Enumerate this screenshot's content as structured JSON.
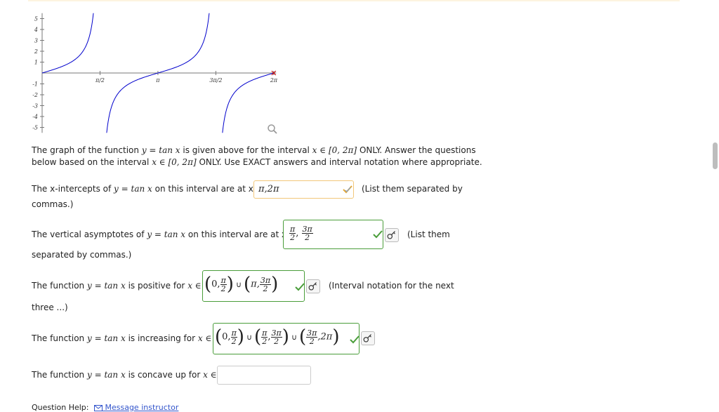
{
  "graph": {
    "y_labels": [
      "5",
      "4",
      "3",
      "2",
      "1",
      "-1",
      "-2",
      "-3",
      "-4",
      "-5"
    ],
    "x_labels": [
      "π/2",
      "π",
      "3π/2",
      "2π"
    ],
    "curve_color": "#0000cc"
  },
  "intro": {
    "line1_a": "The graph of the function",
    "line1_eq": "y = tan x",
    "line1_b": "is given above for the interval",
    "line1_int": "x ∈ [0, 2π]",
    "line1_c": "ONLY. Answer the questions",
    "line2_a": "below based on the interval",
    "line2_int": "x ∈ [0, 2π]",
    "line2_b": "ONLY. Use EXACT answers and interval notation where appropriate."
  },
  "q1": {
    "prefix": "The x-intercepts of",
    "eq": "y = tan x",
    "mid": "on this interval are at x =",
    "answer": "π,2π",
    "hint": "(List them separated by",
    "hint2": "commas.)"
  },
  "q2": {
    "prefix": "The vertical asymptotes of",
    "eq": "y = tan x",
    "mid": "on this interval are at x =",
    "f1_num": "π",
    "f1_den": "2",
    "sep": ",",
    "f2_num": "3π",
    "f2_den": "2",
    "hint": "(List them",
    "hint2": "separated by commas.)"
  },
  "q3": {
    "prefix": "The function",
    "eq": "y = tan x",
    "mid": "is positive for",
    "var": "x ∈",
    "zero": "0,",
    "f1_num": "π",
    "f1_den": "2",
    "cup": "∪",
    "pi": "π,",
    "f2_num": "3π",
    "f2_den": "2",
    "hint": "(Interval notation for the next",
    "hint2": "three ...)"
  },
  "q4": {
    "prefix": "The function",
    "eq": "y = tan x",
    "mid": "is increasing for",
    "var": "x ∈",
    "zero": "0,",
    "f1_num": "π",
    "f1_den": "2",
    "cup": "∪",
    "f2_num": "π",
    "f2_den": "2",
    "sep": ",",
    "f3_num": "3π",
    "f3_den": "2",
    "f4_num": "3π",
    "f4_den": "2",
    "end": ",2π"
  },
  "q5": {
    "prefix": "The function",
    "eq": "y = tan x",
    "mid": "is concave up for",
    "var": "x ∈",
    "answer": ""
  },
  "help": {
    "label": "Question Help:",
    "link": "Message instructor"
  },
  "colors": {
    "correct": "#4a9d3a",
    "pending": "#f2c77a",
    "link": "#3355cc"
  }
}
